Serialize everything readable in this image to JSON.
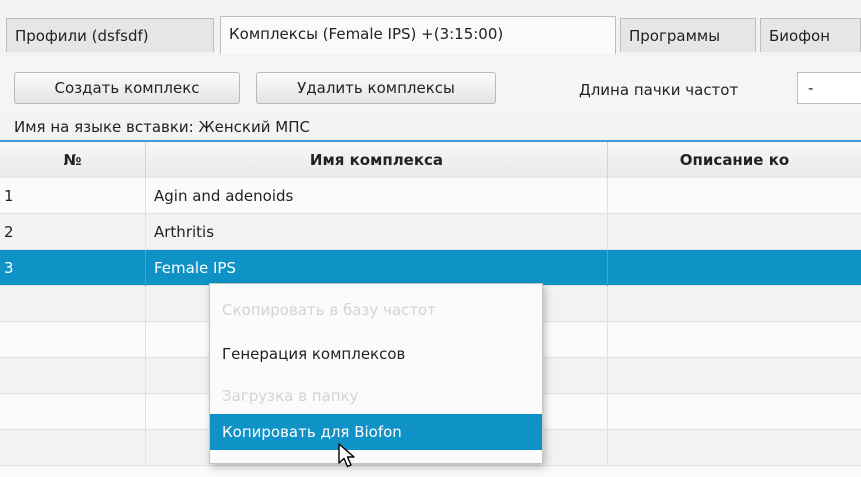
{
  "tabs": [
    {
      "label": "Профили (dsfsdf)"
    },
    {
      "label": "Комплексы (Female IPS) +(3:15:00)",
      "active": true
    },
    {
      "label": "Программы"
    },
    {
      "label": "Биофон"
    }
  ],
  "toolbar": {
    "create_label": "Создать комплекс",
    "delete_label": "Удалить комплексы",
    "length_label": "Длина пачки частот",
    "length_value": "-"
  },
  "lang_line": "Имя на языке вставки:  Женский МПС",
  "table": {
    "columns": [
      "№",
      "Имя комплекса",
      "Описание ко"
    ],
    "rows": [
      {
        "num": "1",
        "name": "Agin and adenoids",
        "desc": ""
      },
      {
        "num": "2",
        "name": "Arthritis",
        "desc": ""
      },
      {
        "num": "3",
        "name": "Female IPS",
        "desc": "",
        "selected": true
      },
      {
        "num": "",
        "name": "",
        "desc": ""
      },
      {
        "num": "",
        "name": "",
        "desc": ""
      },
      {
        "num": "",
        "name": "",
        "desc": ""
      },
      {
        "num": "",
        "name": "",
        "desc": ""
      },
      {
        "num": "",
        "name": "",
        "desc": ""
      }
    ]
  },
  "context_menu": {
    "items": [
      {
        "label": "Скопировать в  базу частот",
        "enabled": false
      },
      {
        "label": "Генерация комплексов",
        "enabled": true
      },
      {
        "label": "Загрузка в папку",
        "enabled": false
      },
      {
        "label": "Копировать для Biofon",
        "enabled": true,
        "hovered": true
      }
    ]
  },
  "colors": {
    "accent": "#0f93c7",
    "header_line": "#3d9dd3",
    "disabled_text": "#d3d3d3"
  }
}
